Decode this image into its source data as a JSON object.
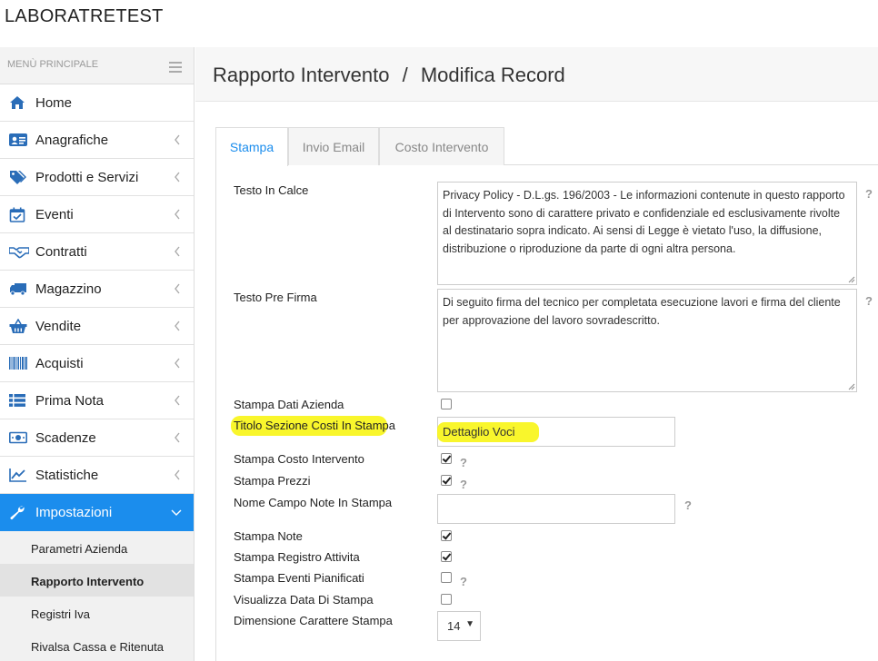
{
  "app": {
    "brand": "LABORATRETEST"
  },
  "sidebar": {
    "header": "MENÙ PRINCIPALE",
    "items": [
      {
        "label": "Home",
        "icon": "home-icon"
      },
      {
        "label": "Anagrafiche",
        "icon": "address-card-icon"
      },
      {
        "label": "Prodotti e Servizi",
        "icon": "tags-icon"
      },
      {
        "label": "Eventi",
        "icon": "calendar-check-icon"
      },
      {
        "label": "Contratti",
        "icon": "handshake-icon"
      },
      {
        "label": "Magazzino",
        "icon": "truck-icon"
      },
      {
        "label": "Vendite",
        "icon": "basket-icon"
      },
      {
        "label": "Acquisti",
        "icon": "barcode-icon"
      },
      {
        "label": "Prima Nota",
        "icon": "list-icon"
      },
      {
        "label": "Scadenze",
        "icon": "money-bill-icon"
      },
      {
        "label": "Statistiche",
        "icon": "line-chart-icon"
      },
      {
        "label": "Impostazioni",
        "icon": "wrench-icon"
      }
    ],
    "submenu": [
      {
        "label": "Parametri Azienda"
      },
      {
        "label": "Rapporto Intervento"
      },
      {
        "label": "Registri Iva"
      },
      {
        "label": "Rivalsa Cassa e Ritenuta"
      }
    ]
  },
  "page": {
    "title": "Rapporto Intervento",
    "separator": "/",
    "subtitle": "Modifica Record"
  },
  "tabs": [
    {
      "label": "Stampa"
    },
    {
      "label": "Invio Email"
    },
    {
      "label": "Costo Intervento"
    }
  ],
  "form": {
    "testo_in_calce": {
      "label": "Testo In Calce",
      "value": "Privacy Policy - D.L.gs. 196/2003 - Le informazioni contenute in questo rapporto di Intervento sono di carattere privato e confidenziale ed esclusivamente rivolte al destinatario sopra indicato. Ai sensi di Legge è vietato l'uso, la diffusione, distribuzione o riproduzione da parte di ogni altra persona."
    },
    "testo_pre_firma": {
      "label": "Testo Pre Firma",
      "value": "Di seguito firma del tecnico per completata esecuzione lavori e firma del cliente per approvazione del lavoro sovradescritto."
    },
    "stampa_dati_azienda": {
      "label": "Stampa Dati Azienda",
      "checked": false
    },
    "titolo_sezione_costi": {
      "label": "Titolo Sezione Costi In Stampa",
      "value": "Dettaglio Voci"
    },
    "stampa_costo_intervento": {
      "label": "Stampa Costo Intervento",
      "checked": true
    },
    "stampa_prezzi": {
      "label": "Stampa Prezzi",
      "checked": true
    },
    "nome_campo_note": {
      "label": "Nome Campo Note In Stampa",
      "value": ""
    },
    "stampa_note": {
      "label": "Stampa Note",
      "checked": true
    },
    "stampa_registro_attivita": {
      "label": "Stampa Registro Attivita",
      "checked": true
    },
    "stampa_eventi_pianificati": {
      "label": "Stampa Eventi Pianificati",
      "checked": false
    },
    "visualizza_data_stampa": {
      "label": "Visualizza Data Di Stampa",
      "checked": false
    },
    "dimensione_carattere": {
      "label": "Dimensione Carattere Stampa",
      "value": "14"
    },
    "help_mark": "?"
  },
  "colors": {
    "accent": "#1b8ded",
    "icon": "#2a6db8",
    "highlight": "#f8f51a"
  }
}
